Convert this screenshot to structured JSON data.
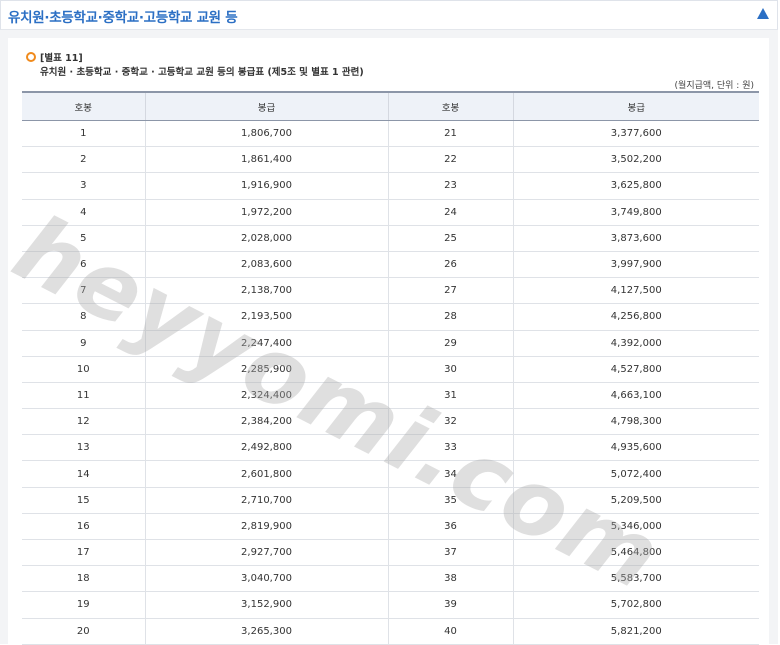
{
  "header": {
    "title": "유치원·초등학교·중학교·고등학교 교원 등",
    "collapse_icon": "triangle-up-icon"
  },
  "caption": {
    "icon": "circle-bullet-icon",
    "label": "[별표 11]",
    "title": "유치원 · 초등학교 · 중학교 · 고등학교 교원 등의 봉급표 (제5조 및 별표 1 관련)"
  },
  "unit_note": "(월지급액, 단위 : 원)",
  "table": {
    "headers": [
      "호봉",
      "봉급",
      "호봉",
      "봉급"
    ],
    "rows": [
      [
        "1",
        "1,806,700",
        "21",
        "3,377,600"
      ],
      [
        "2",
        "1,861,400",
        "22",
        "3,502,200"
      ],
      [
        "3",
        "1,916,900",
        "23",
        "3,625,800"
      ],
      [
        "4",
        "1,972,200",
        "24",
        "3,749,800"
      ],
      [
        "5",
        "2,028,000",
        "25",
        "3,873,600"
      ],
      [
        "6",
        "2,083,600",
        "26",
        "3,997,900"
      ],
      [
        "7",
        "2,138,700",
        "27",
        "4,127,500"
      ],
      [
        "8",
        "2,193,500",
        "28",
        "4,256,800"
      ],
      [
        "9",
        "2,247,400",
        "29",
        "4,392,000"
      ],
      [
        "10",
        "2,285,900",
        "30",
        "4,527,800"
      ],
      [
        "11",
        "2,324,400",
        "31",
        "4,663,100"
      ],
      [
        "12",
        "2,384,200",
        "32",
        "4,798,300"
      ],
      [
        "13",
        "2,492,800",
        "33",
        "4,935,600"
      ],
      [
        "14",
        "2,601,800",
        "34",
        "5,072,400"
      ],
      [
        "15",
        "2,710,700",
        "35",
        "5,209,500"
      ],
      [
        "16",
        "2,819,900",
        "36",
        "5,346,000"
      ],
      [
        "17",
        "2,927,700",
        "37",
        "5,464,800"
      ],
      [
        "18",
        "3,040,700",
        "38",
        "5,583,700"
      ],
      [
        "19",
        "3,152,900",
        "39",
        "5,702,800"
      ],
      [
        "20",
        "3,265,300",
        "40",
        "5,821,200"
      ]
    ]
  },
  "watermark": "heyyomi.com",
  "colors": {
    "accent": "#2b6fc4",
    "bullet": "#f08a1c",
    "header_bg": "#eef2f8"
  }
}
